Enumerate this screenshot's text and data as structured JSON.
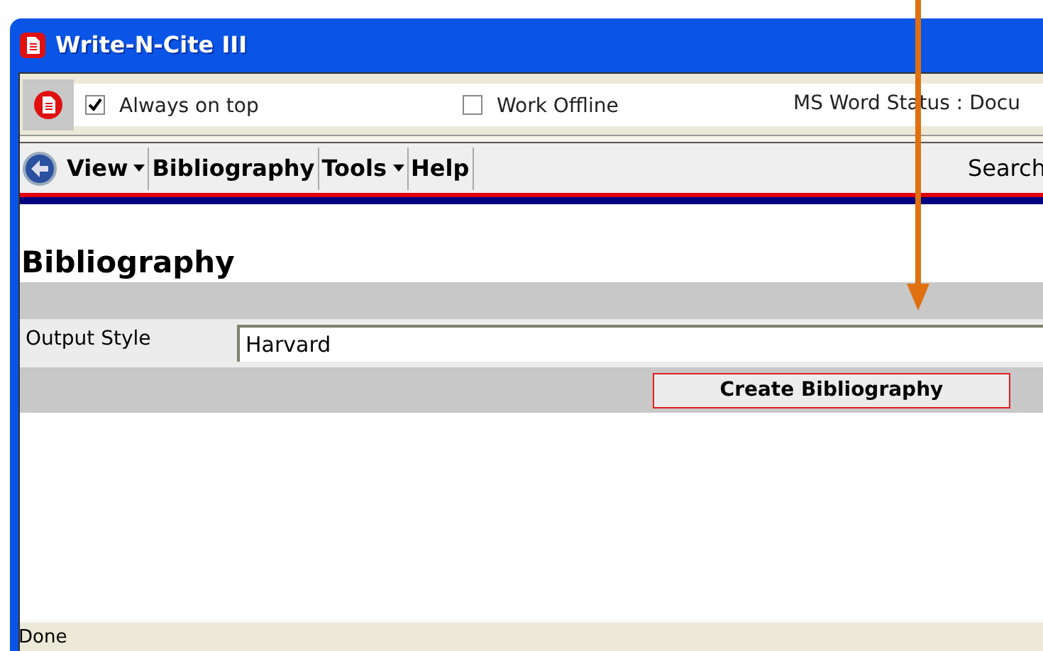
{
  "window": {
    "title": "Write-N-Cite III"
  },
  "toolbar": {
    "checkboxes": [
      {
        "label": "Always on top",
        "checked": true
      },
      {
        "label": "Work Offline",
        "checked": false
      }
    ],
    "status": "MS Word Status : Docu"
  },
  "menu": {
    "items": [
      {
        "label": "View",
        "dropdown": true
      },
      {
        "label": "Bibliography",
        "dropdown": false
      },
      {
        "label": "Tools",
        "dropdown": true
      },
      {
        "label": "Help",
        "dropdown": false
      }
    ],
    "search": "Search"
  },
  "page": {
    "heading": "Bibliography",
    "output_style_label": "Output Style",
    "output_style_value": "Harvard",
    "button": "Create Bibliography"
  },
  "status_bar": "Done"
}
